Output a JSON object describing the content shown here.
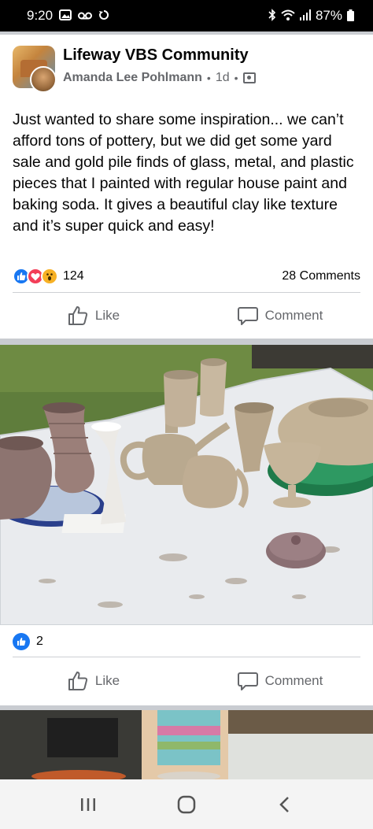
{
  "status_bar": {
    "time": "9:20",
    "battery": "87%",
    "icons": [
      "gallery-icon",
      "voicemail-icon",
      "sync-icon",
      "bluetooth-icon",
      "wifi-icon",
      "signal-icon",
      "battery-icon"
    ]
  },
  "post": {
    "group_name": "Lifeway VBS Community",
    "author": "Amanda Lee Pohlmann",
    "time": "1d",
    "separator": "•",
    "body": "Just wanted to share some inspiration... we can’t afford tons of pottery, but we did get some yard sale and gold pile finds of glass, metal, and plastic pieces that I painted with regular house paint and baking soda. It gives a beautiful clay like texture and it’s super quick and easy!",
    "reaction_count": "124",
    "reaction_types": [
      "like",
      "love",
      "wow"
    ],
    "comment_count": "28 Comments",
    "actions": {
      "like": "Like",
      "comment": "Comment"
    }
  },
  "photo_post": {
    "reaction_count": "2",
    "actions": {
      "like": "Like",
      "comment": "Comment"
    }
  },
  "nav": {
    "buttons": [
      "recent-apps",
      "home",
      "back"
    ]
  },
  "colors": {
    "accent": "#1877f2",
    "love": "#f33e58",
    "wow": "#f7b125",
    "secondary_text": "#65676b",
    "divider": "#ced0d4"
  }
}
